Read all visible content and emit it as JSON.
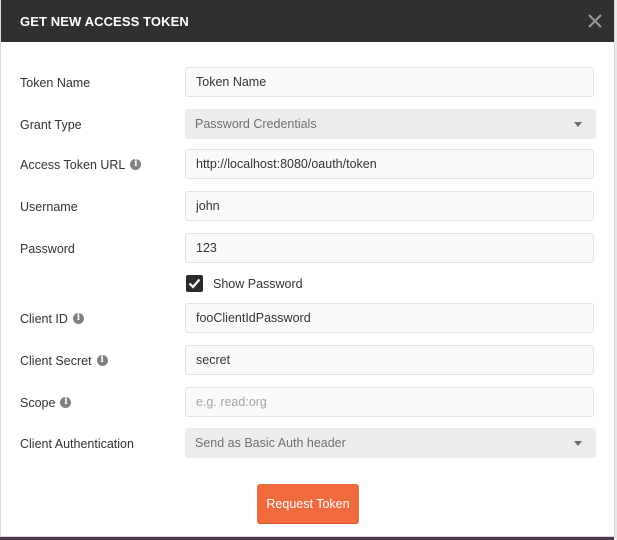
{
  "dialog": {
    "title": "GET NEW ACCESS TOKEN",
    "close_icon": "close-icon"
  },
  "fields": {
    "token_name": {
      "label": "Token Name",
      "value": "Token Name",
      "placeholder": ""
    },
    "grant_type": {
      "label": "Grant Type",
      "value": "Password Credentials"
    },
    "access_token_url": {
      "label": "Access Token URL",
      "value": "http://localhost:8080/oauth/token"
    },
    "username": {
      "label": "Username",
      "value": "john"
    },
    "password": {
      "label": "Password",
      "value": "123"
    },
    "show_password": {
      "label": "Show Password",
      "checked": true
    },
    "client_id": {
      "label": "Client ID",
      "value": "fooClientIdPassword"
    },
    "client_secret": {
      "label": "Client Secret",
      "value": "secret"
    },
    "scope": {
      "label": "Scope",
      "value": "",
      "placeholder": "e.g. read:org"
    },
    "client_authentication": {
      "label": "Client Authentication",
      "value": "Send as Basic Auth header"
    }
  },
  "info_glyph": "i",
  "actions": {
    "request_token_label": "Request Token"
  },
  "colors": {
    "header_bg": "#303030",
    "accent": "#ef6a3c",
    "select_bg": "#ececec",
    "input_bg": "#fafafa"
  }
}
